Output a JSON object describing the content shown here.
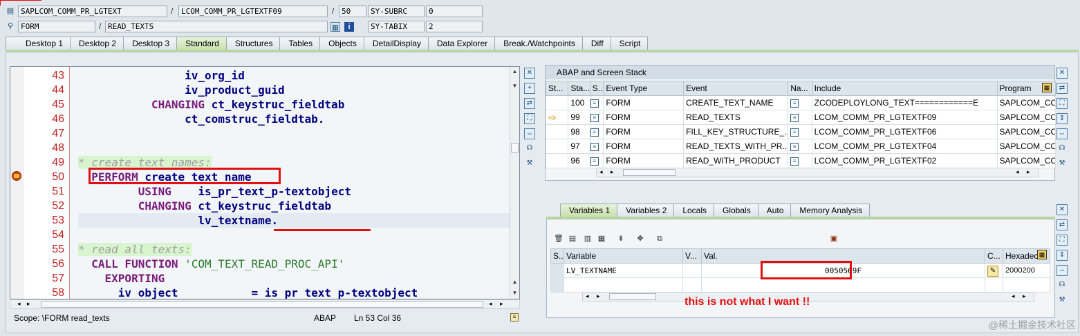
{
  "header": {
    "row1": {
      "program": "SAPLCOM_COMM_PR_LGTEXT",
      "include": "LCOM_COMM_PR_LGTEXTF09",
      "line": "50",
      "sysfield": "SY-SUBRC",
      "sysvalue": "0"
    },
    "row2": {
      "type": "FORM",
      "name": "READ_TEXTS",
      "sysfield": "SY-TABIX",
      "sysvalue": "2"
    }
  },
  "tabs": [
    "Desktop 1",
    "Desktop 2",
    "Desktop 3",
    "Standard",
    "Structures",
    "Tables",
    "Objects",
    "DetailDisplay",
    "Data Explorer",
    "Break./Watchpoints",
    "Diff",
    "Script"
  ],
  "active_tab": "Standard",
  "editor": {
    "lines": [
      {
        "n": "43",
        "parts": [
          {
            "t": "                iv_org_id",
            "c": "var"
          }
        ]
      },
      {
        "n": "44",
        "parts": [
          {
            "t": "                iv_product_guid",
            "c": "var"
          }
        ]
      },
      {
        "n": "45",
        "parts": [
          {
            "t": "           ",
            "c": ""
          },
          {
            "t": "CHANGING",
            "c": "kw"
          },
          {
            "t": " ct_keystruc_fieldtab",
            "c": "var"
          }
        ]
      },
      {
        "n": "46",
        "parts": [
          {
            "t": "                ct_comstruc_fieldtab.",
            "c": "var"
          }
        ]
      },
      {
        "n": "47",
        "parts": []
      },
      {
        "n": "48",
        "parts": []
      },
      {
        "n": "49",
        "parts": [
          {
            "t": "* create text names:",
            "c": "cm"
          }
        ]
      },
      {
        "n": "50",
        "parts": [
          {
            "t": "  ",
            "c": ""
          },
          {
            "t": "PERFORM",
            "c": "kw"
          },
          {
            "t": " create text name",
            "c": "var"
          }
        ]
      },
      {
        "n": "51",
        "parts": [
          {
            "t": "         ",
            "c": ""
          },
          {
            "t": "USING",
            "c": "kw"
          },
          {
            "t": "    is_pr_text_p-textobject",
            "c": "var"
          }
        ]
      },
      {
        "n": "52",
        "parts": [
          {
            "t": "         ",
            "c": ""
          },
          {
            "t": "CHANGING",
            "c": "kw"
          },
          {
            "t": " ct_keystruc_fieldtab",
            "c": "var"
          }
        ]
      },
      {
        "n": "53",
        "parts": [
          {
            "t": "                  lv_textname.",
            "c": "var"
          }
        ]
      },
      {
        "n": "54",
        "parts": []
      },
      {
        "n": "55",
        "parts": [
          {
            "t": "* read all texts:",
            "c": "cm"
          }
        ]
      },
      {
        "n": "56",
        "parts": [
          {
            "t": "  ",
            "c": ""
          },
          {
            "t": "CALL FUNCTION",
            "c": "kw"
          },
          {
            "t": " ",
            "c": ""
          },
          {
            "t": "'COM_TEXT_READ_PROC_API'",
            "c": "str"
          }
        ]
      },
      {
        "n": "57",
        "parts": [
          {
            "t": "    ",
            "c": ""
          },
          {
            "t": "EXPORTING",
            "c": "kw"
          }
        ]
      },
      {
        "n": "58",
        "parts": [
          {
            "t": "      iv object           = is pr text p-textobject",
            "c": "var"
          }
        ]
      }
    ]
  },
  "status": {
    "scope": "Scope: \\FORM read_texts",
    "lang": "ABAP",
    "position": "Ln  53 Col  36"
  },
  "stack": {
    "title": "ABAP and Screen Stack",
    "columns": [
      "St...",
      "Sta...",
      "S...",
      "Event Type",
      "Event",
      "Na...",
      "Include",
      "Program"
    ],
    "rows": [
      {
        "level": "100",
        "type": "FORM",
        "event": "CREATE_TEXT_NAME",
        "include": "ZCODEPLOYLONG_TEXT============E",
        "program": "SAPLCOM_CO",
        "current": false
      },
      {
        "level": "99",
        "type": "FORM",
        "event": "READ_TEXTS",
        "include": "LCOM_COMM_PR_LGTEXTF09",
        "program": "SAPLCOM_CO",
        "current": true
      },
      {
        "level": "98",
        "type": "FORM",
        "event": "FILL_KEY_STRUCTURE_...",
        "include": "LCOM_COMM_PR_LGTEXTF06",
        "program": "SAPLCOM_CO",
        "current": false
      },
      {
        "level": "97",
        "type": "FORM",
        "event": "READ_TEXTS_WITH_PR...",
        "include": "LCOM_COMM_PR_LGTEXTF04",
        "program": "SAPLCOM_CO",
        "current": false
      },
      {
        "level": "96",
        "type": "FORM",
        "event": "READ_WITH_PRODUCT",
        "include": "LCOM_COMM_PR_LGTEXTF02",
        "program": "SAPLCOM_CO",
        "current": false
      }
    ]
  },
  "vars_tabs": [
    "Variables 1",
    "Variables 2",
    "Locals",
    "Globals",
    "Auto",
    "Memory Analysis"
  ],
  "vars": {
    "columns": [
      "S...",
      "Variable",
      "V...",
      "Val.",
      "C...",
      "Hexadec"
    ],
    "rows": [
      {
        "variable": "LV_TEXTNAME",
        "value": "0050569F",
        "hex": "2000200"
      }
    ]
  },
  "annotation": "this is not what I want !!",
  "watermark": "@稀土掘金技术社区"
}
